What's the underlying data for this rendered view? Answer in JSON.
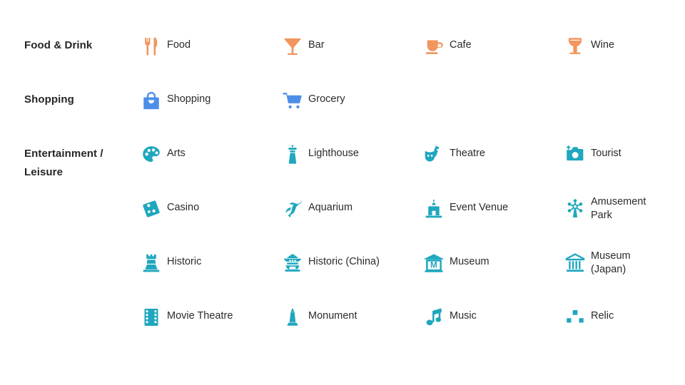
{
  "legend": {
    "colors": {
      "food_drink": "#F2955E",
      "shopping": "#4D8FE8",
      "entertainment": "#1FA7BE",
      "text": "#2b2b2b",
      "category_text": "#262626",
      "background": "#ffffff"
    },
    "categories": [
      {
        "name": "Food & Drink",
        "color_key": "food_drink",
        "rows": [
          {
            "items": [
              {
                "label": "Food",
                "icon": "fork-knife-icon"
              },
              {
                "label": "Bar",
                "icon": "cocktail-glass-icon"
              },
              {
                "label": "Cafe",
                "icon": "coffee-cup-icon"
              },
              {
                "label": "Wine",
                "icon": "wine-glass-icon"
              }
            ]
          }
        ]
      },
      {
        "name": "Shopping",
        "color_key": "shopping",
        "rows": [
          {
            "items": [
              {
                "label": "Shopping",
                "icon": "shopping-bag-icon"
              },
              {
                "label": "Grocery",
                "icon": "shopping-cart-icon"
              },
              {
                "label": "",
                "icon": ""
              },
              {
                "label": "",
                "icon": ""
              }
            ]
          }
        ]
      },
      {
        "name": "Entertainment / Leisure",
        "name_line1": "Entertainment /",
        "name_line2": "Leisure",
        "color_key": "entertainment",
        "rows": [
          {
            "items": [
              {
                "label": "Arts",
                "icon": "palette-icon"
              },
              {
                "label": "Lighthouse",
                "icon": "lighthouse-icon"
              },
              {
                "label": "Theatre",
                "icon": "theatre-masks-icon"
              },
              {
                "label": "Tourist",
                "icon": "camera-icon"
              }
            ]
          },
          {
            "items": [
              {
                "label": "Casino",
                "icon": "dice-icon"
              },
              {
                "label": "Aquarium",
                "icon": "dolphin-icon"
              },
              {
                "label": "Event Venue",
                "icon": "event-venue-icon"
              },
              {
                "label": "Amusement Park",
                "label_line1": "Amusement",
                "label_line2": "Park",
                "icon": "ferris-wheel-icon"
              }
            ]
          },
          {
            "items": [
              {
                "label": "Historic",
                "icon": "castle-tower-icon"
              },
              {
                "label": "Historic (China)",
                "icon": "pagoda-icon"
              },
              {
                "label": "Museum",
                "icon": "museum-m-icon"
              },
              {
                "label": "Museum (Japan)",
                "label_line1": "Museum",
                "label_line2": "(Japan)",
                "icon": "museum-columns-icon"
              }
            ]
          },
          {
            "items": [
              {
                "label": "Movie Theatre",
                "icon": "film-strip-icon"
              },
              {
                "label": "Monument",
                "icon": "monument-icon"
              },
              {
                "label": "Music",
                "icon": "music-note-icon"
              },
              {
                "label": "Relic",
                "icon": "relic-blocks-icon"
              }
            ]
          }
        ]
      }
    ]
  }
}
